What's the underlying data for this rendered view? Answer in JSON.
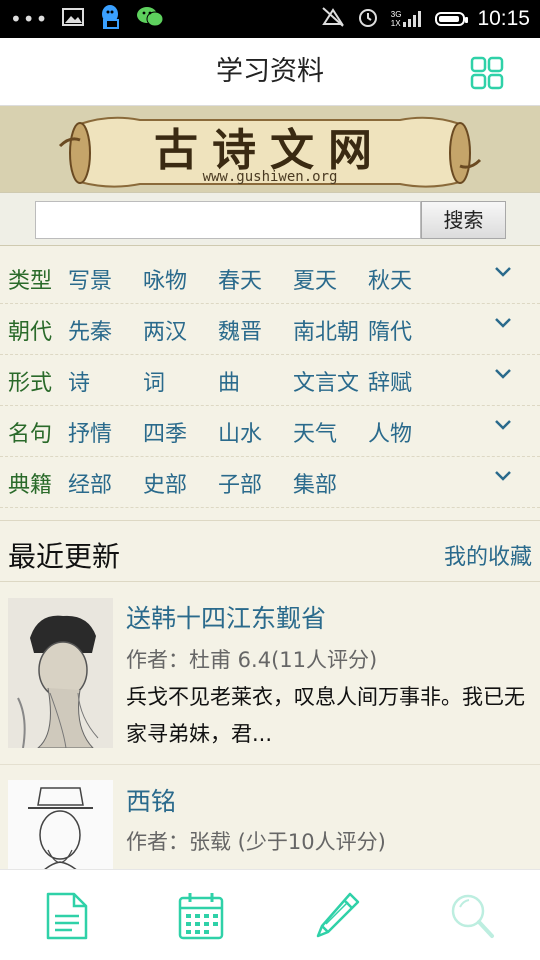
{
  "status_bar": {
    "dots": "•••",
    "time": "10:15",
    "signal_top": "3G",
    "signal_bottom": "1X",
    "icons": [
      "image-icon",
      "qq-icon",
      "wechat-icon",
      "mute-icon",
      "alarm-icon",
      "signal-icon",
      "battery-icon"
    ]
  },
  "header": {
    "title": "学习资料",
    "menu_icon": "grid-icon"
  },
  "banner": {
    "logo_text": "古诗文网",
    "logo_url": "www.gushiwen.org"
  },
  "search": {
    "value": "",
    "placeholder": "",
    "button_label": "搜索"
  },
  "categories": [
    {
      "label": "类型",
      "items": [
        "写景",
        "咏物",
        "春天",
        "夏天",
        "秋天"
      ]
    },
    {
      "label": "朝代",
      "items": [
        "先秦",
        "两汉",
        "魏晋",
        "南北朝",
        "隋代"
      ]
    },
    {
      "label": "形式",
      "items": [
        "诗",
        "词",
        "曲",
        "文言文",
        "辞赋"
      ]
    },
    {
      "label": "名句",
      "items": [
        "抒情",
        "四季",
        "山水",
        "天气",
        "人物"
      ]
    },
    {
      "label": "典籍",
      "items": [
        "经部",
        "史部",
        "子部",
        "集部"
      ]
    }
  ],
  "recent": {
    "title": "最近更新",
    "favorites_label": "我的收藏",
    "items": [
      {
        "title": "送韩十四江东觐省",
        "meta": "作者：杜甫 6.4(11人评分)",
        "excerpt": "兵戈不见老莱衣，叹息人间万事非。我已无家寻弟妹，君..."
      },
      {
        "title": "西铭",
        "meta": "作者：张载 (少于10人评分)",
        "excerpt": ""
      }
    ]
  },
  "bottom_nav": {
    "items": [
      "document-icon",
      "calendar-icon",
      "pencil-icon",
      "search-icon"
    ]
  },
  "colors": {
    "accent": "#2fd1a8",
    "link": "#2a6a8c",
    "category_label": "#2a6a2a",
    "background": "#f4f2e6"
  }
}
